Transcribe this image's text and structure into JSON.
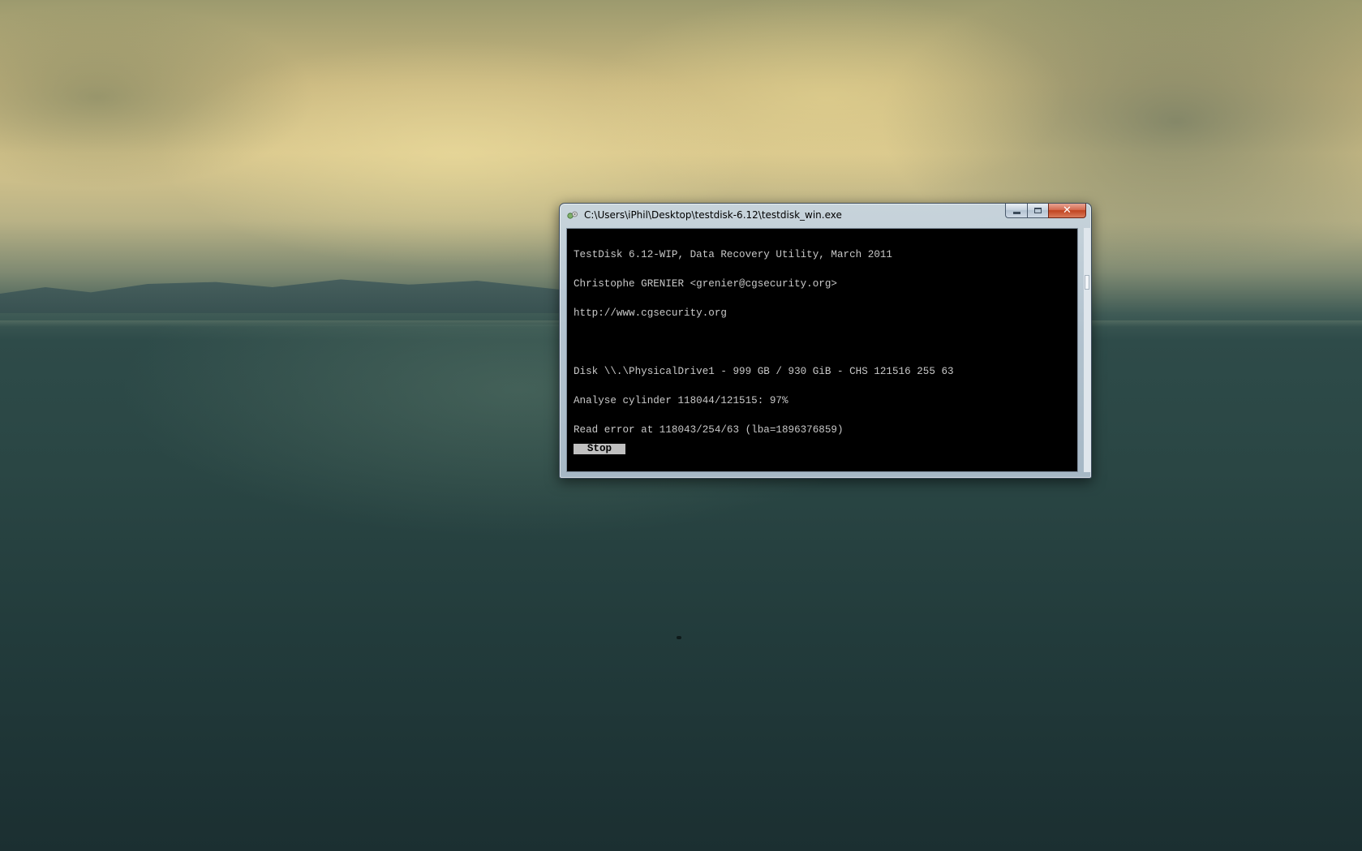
{
  "window": {
    "title": "C:\\Users\\iPhil\\Desktop\\testdisk-6.12\\testdisk_win.exe",
    "buttons": {
      "minimize_icon": "minimize-icon",
      "maximize_icon": "maximize-icon",
      "close_icon": "close-icon",
      "close_glyph": "✕"
    }
  },
  "console": {
    "lines": [
      "TestDisk 6.12-WIP, Data Recovery Utility, March 2011",
      "Christophe GRENIER <grenier@cgsecurity.org>",
      "http://www.cgsecurity.org",
      "",
      "Disk \\\\.\\PhysicalDrive1 - 999 GB / 930 GiB - CHS 121516 255 63",
      "Analyse cylinder 118044/121515: 97%",
      "Read error at 118043/254/63 (lba=1896376859)"
    ],
    "stop_label": "Stop"
  },
  "colors": {
    "console_background": "#000000",
    "console_text": "#c8c8c8",
    "stop_button_background": "#c0c0c0",
    "close_button": "#c0431f"
  }
}
